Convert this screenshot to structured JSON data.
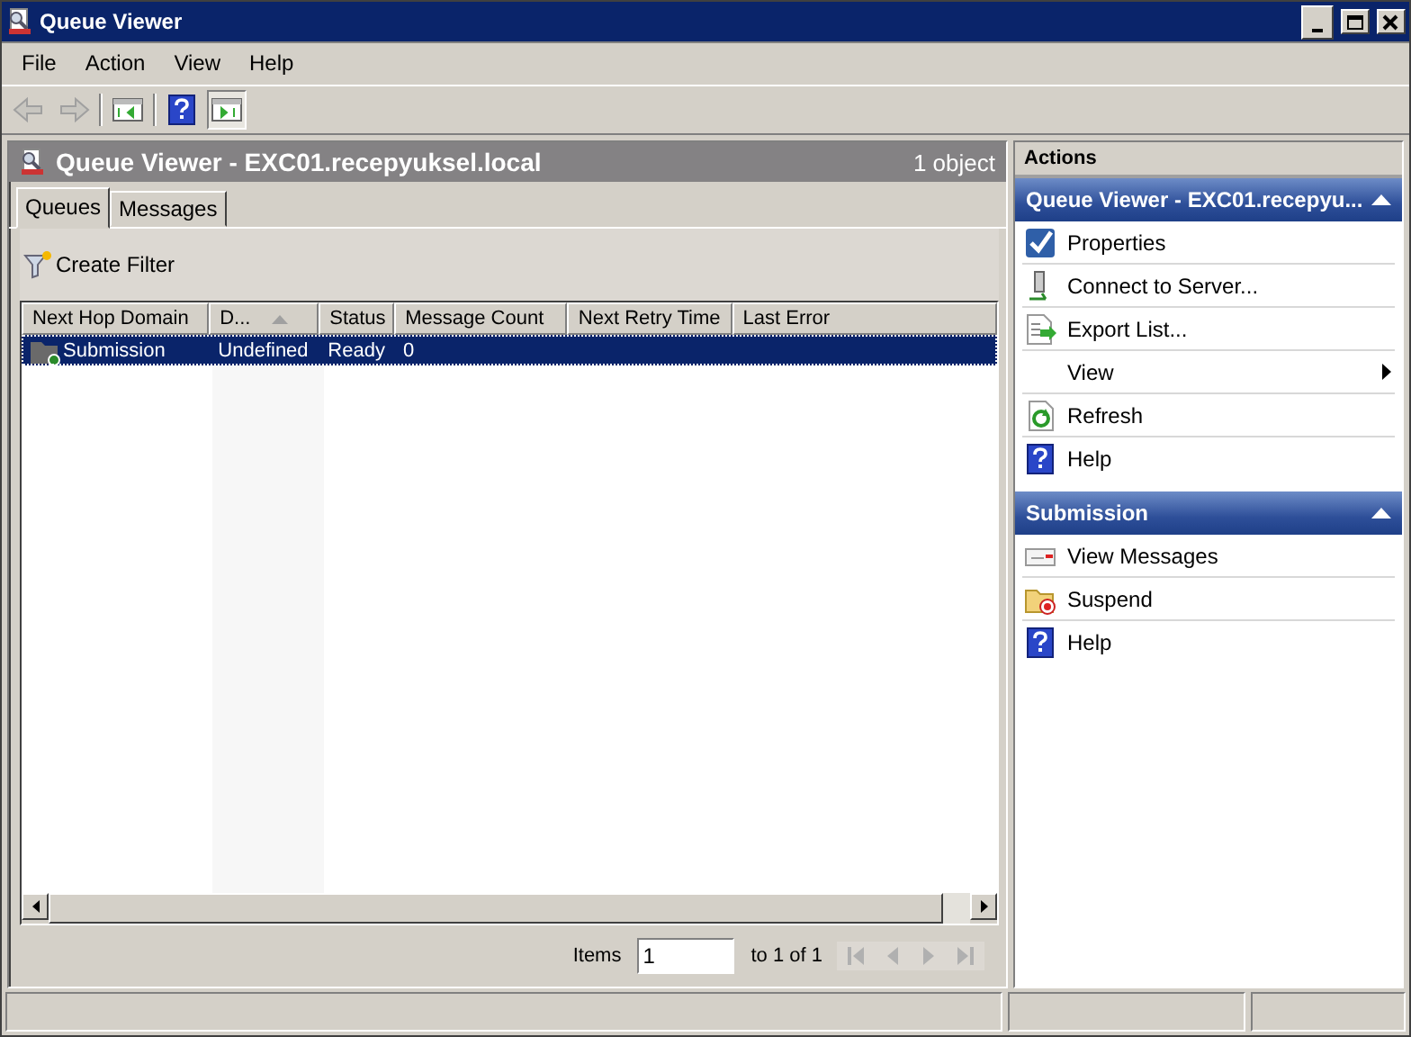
{
  "window": {
    "title": "Queue Viewer"
  },
  "menu": [
    "File",
    "Action",
    "View",
    "Help"
  ],
  "toolbar": [
    {
      "kind": "back",
      "disabled": true
    },
    {
      "kind": "forward",
      "disabled": true
    },
    {
      "kind": "tree",
      "pressed": false
    },
    {
      "kind": "help",
      "pressed": false
    },
    {
      "kind": "actions",
      "pressed": true
    }
  ],
  "main": {
    "title": "Queue Viewer - EXC01.recepyuksel.local",
    "count": "1 object",
    "tabs": [
      {
        "label": "Queues",
        "selected": true
      },
      {
        "label": "Messages",
        "selected": false
      }
    ],
    "filter_button": "Create Filter",
    "table": {
      "columns": [
        {
          "label": "Next Hop Domain",
          "sorted": false
        },
        {
          "label": "D...",
          "sorted": true
        },
        {
          "label": "Status",
          "sorted": false
        },
        {
          "label": "Message Count",
          "sorted": false
        },
        {
          "label": "Next Retry Time",
          "sorted": false
        },
        {
          "label": "Last Error",
          "sorted": false
        }
      ],
      "rows": [
        {
          "selected": true,
          "cells": [
            "Submission",
            "Undefined",
            "Ready",
            "0",
            "",
            ""
          ]
        }
      ]
    },
    "pager": {
      "label": "Items",
      "value": "1",
      "range": "to 1 of 1"
    }
  },
  "actions": {
    "title": "Actions",
    "sections": [
      {
        "title": "Queue Viewer - EXC01.recepyu...",
        "expanded": true,
        "items": [
          {
            "label": "Properties",
            "kind": "properties"
          },
          {
            "label": "Connect to Server...",
            "kind": "connect"
          },
          {
            "label": "Export List...",
            "kind": "export"
          },
          {
            "label": "View",
            "kind": "submenu"
          },
          {
            "label": "Refresh",
            "kind": "refresh"
          },
          {
            "label": "Help",
            "kind": "help"
          }
        ]
      },
      {
        "title": "Submission",
        "expanded": true,
        "items": [
          {
            "label": "View Messages",
            "kind": "messages"
          },
          {
            "label": "Suspend",
            "kind": "suspend"
          },
          {
            "label": "Help",
            "kind": "help"
          }
        ]
      }
    ]
  }
}
